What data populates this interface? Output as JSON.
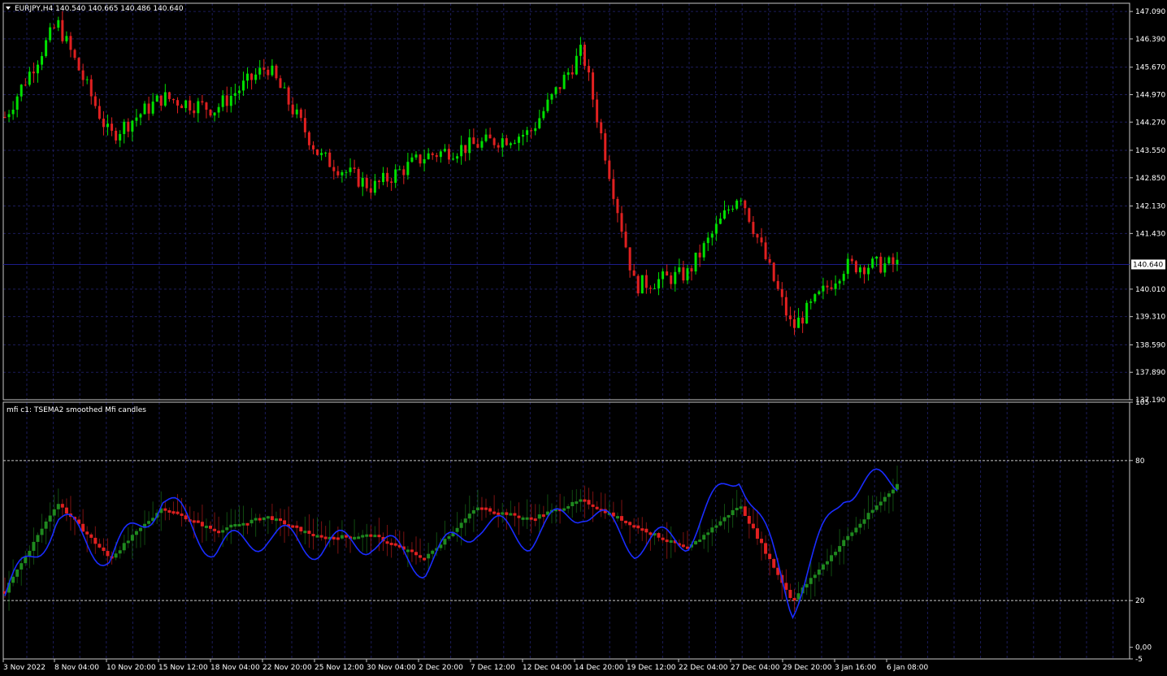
{
  "colors": {
    "bg": "#000000",
    "grid": "#1c1c5a",
    "frame": "#c8c8c8",
    "bull": "#00e000",
    "bear": "#e02020",
    "blue": "#1a2cff",
    "level_line": "#c8c8c8",
    "price_line": "#1c1c8a"
  },
  "chart_data": [
    {
      "type": "line",
      "name": "main-price",
      "symbol_header": "EURJPY,H4",
      "ohlc": "140.540 140.665 140.486 140.640",
      "ylim": [
        137.19,
        147.3
      ],
      "y_ticks": [
        "147.090",
        "146.390",
        "145.670",
        "144.970",
        "144.270",
        "143.550",
        "142.850",
        "142.130",
        "141.430",
        "140.010",
        "139.310",
        "138.590",
        "137.890",
        "137.190"
      ],
      "current_price": "140.640",
      "x_ticks": [
        "3 Nov 2022",
        "8 Nov 04:00",
        "10 Nov 20:00",
        "15 Nov 12:00",
        "18 Nov 04:00",
        "22 Nov 20:00",
        "25 Nov 12:00",
        "30 Nov 04:00",
        "2 Dec 20:00",
        "7 Dec 12:00",
        "12 Dec 04:00",
        "14 Dec 20:00",
        "19 Dec 12:00",
        "22 Dec 04:00",
        "27 Dec 04:00",
        "29 Dec 20:00",
        "3 Jan 16:00",
        "6 Jan 08:00"
      ],
      "x": [
        "3 Nov 2022",
        "8 Nov 04:00",
        "10 Nov 20:00",
        "15 Nov 12:00",
        "18 Nov 04:00",
        "22 Nov 20:00",
        "25 Nov 12:00",
        "30 Nov 04:00",
        "2 Dec 20:00",
        "7 Dec 12:00",
        "12 Dec 04:00",
        "14 Dec 20:00",
        "19 Dec 12:00",
        "22 Dec 04:00",
        "27 Dec 04:00",
        "29 Dec 20:00",
        "3 Jan 16:00",
        "6 Jan 08:00"
      ],
      "close": [
        144.4,
        146.8,
        143.9,
        144.9,
        144.6,
        145.7,
        143.4,
        142.6,
        143.4,
        143.7,
        144.0,
        146.1,
        140.1,
        140.4,
        142.5,
        139.0,
        140.6,
        140.64
      ]
    },
    {
      "type": "line",
      "name": "mfi-indicator",
      "title": "mfi c1: TSEMA2 smoothed Mfi candles",
      "ylim": [
        -5,
        105
      ],
      "y_ticks": [
        "105",
        "80",
        "20",
        "0,00",
        "-5"
      ],
      "levels": [
        80,
        20
      ],
      "level_labels": [
        "80",
        "20"
      ],
      "x": [
        "3 Nov 2022",
        "8 Nov 04:00",
        "10 Nov 20:00",
        "15 Nov 12:00",
        "18 Nov 04:00",
        "22 Nov 20:00",
        "25 Nov 12:00",
        "30 Nov 04:00",
        "2 Dec 20:00",
        "7 Dec 12:00",
        "12 Dec 04:00",
        "14 Dec 20:00",
        "19 Dec 12:00",
        "22 Dec 04:00",
        "27 Dec 04:00",
        "29 Dec 20:00",
        "3 Jan 16:00",
        "6 Jan 08:00"
      ],
      "mfi_line": [
        22,
        55,
        38,
        64,
        42,
        48,
        43,
        46,
        35,
        53,
        47,
        60,
        44,
        47,
        76,
        18,
        68,
        72
      ],
      "smoothed": [
        24,
        62,
        38,
        60,
        50,
        56,
        47,
        48,
        38,
        60,
        55,
        63,
        52,
        42,
        61,
        20,
        46,
        70
      ]
    }
  ]
}
